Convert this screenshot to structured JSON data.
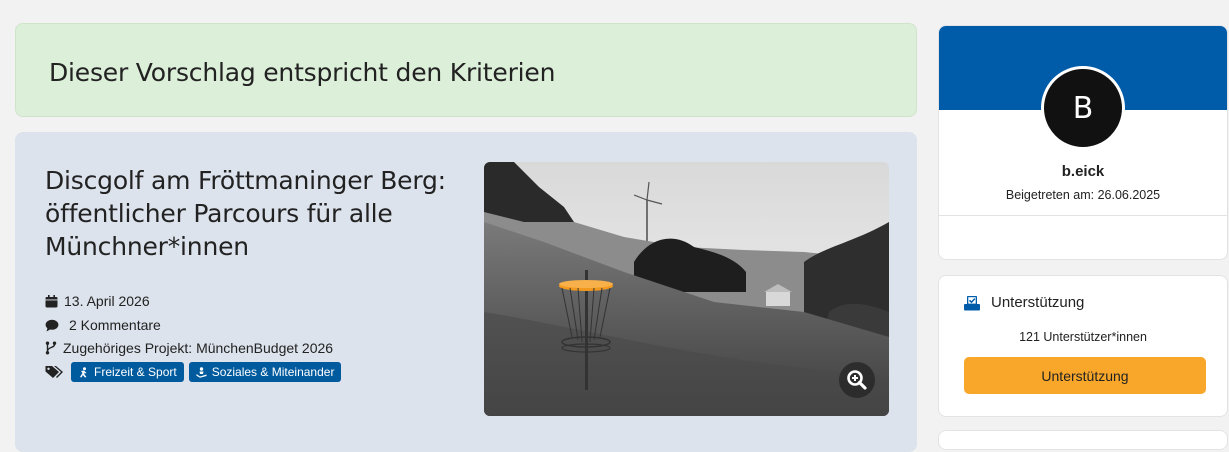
{
  "banner": {
    "text": "Dieser Vorschlag entspricht den Kriterien"
  },
  "proposal": {
    "title": "Discgolf am Fröttmaninger Berg: öffentlicher Parcours für alle Münchner*innen",
    "date": "13. April 2026",
    "comments": "2 Kommentare",
    "project": "Zugehöriges Projekt: MünchenBudget 2026",
    "tags": [
      {
        "label": "Freizeit & Sport",
        "icon": "person-running-icon"
      },
      {
        "label": "Soziales & Miteinander",
        "icon": "person-hands-icon"
      }
    ],
    "image_icon": "zoom-in-icon"
  },
  "profile": {
    "initial": "B",
    "username": "b.eick",
    "joined": "Beigetreten am: 26.06.2025",
    "header_color": "#005ca9"
  },
  "support": {
    "heading": "Unterstützung",
    "count": "121 Unterstützer*innen",
    "button_label": "Unterstützung",
    "button_color": "#f9a72a"
  }
}
